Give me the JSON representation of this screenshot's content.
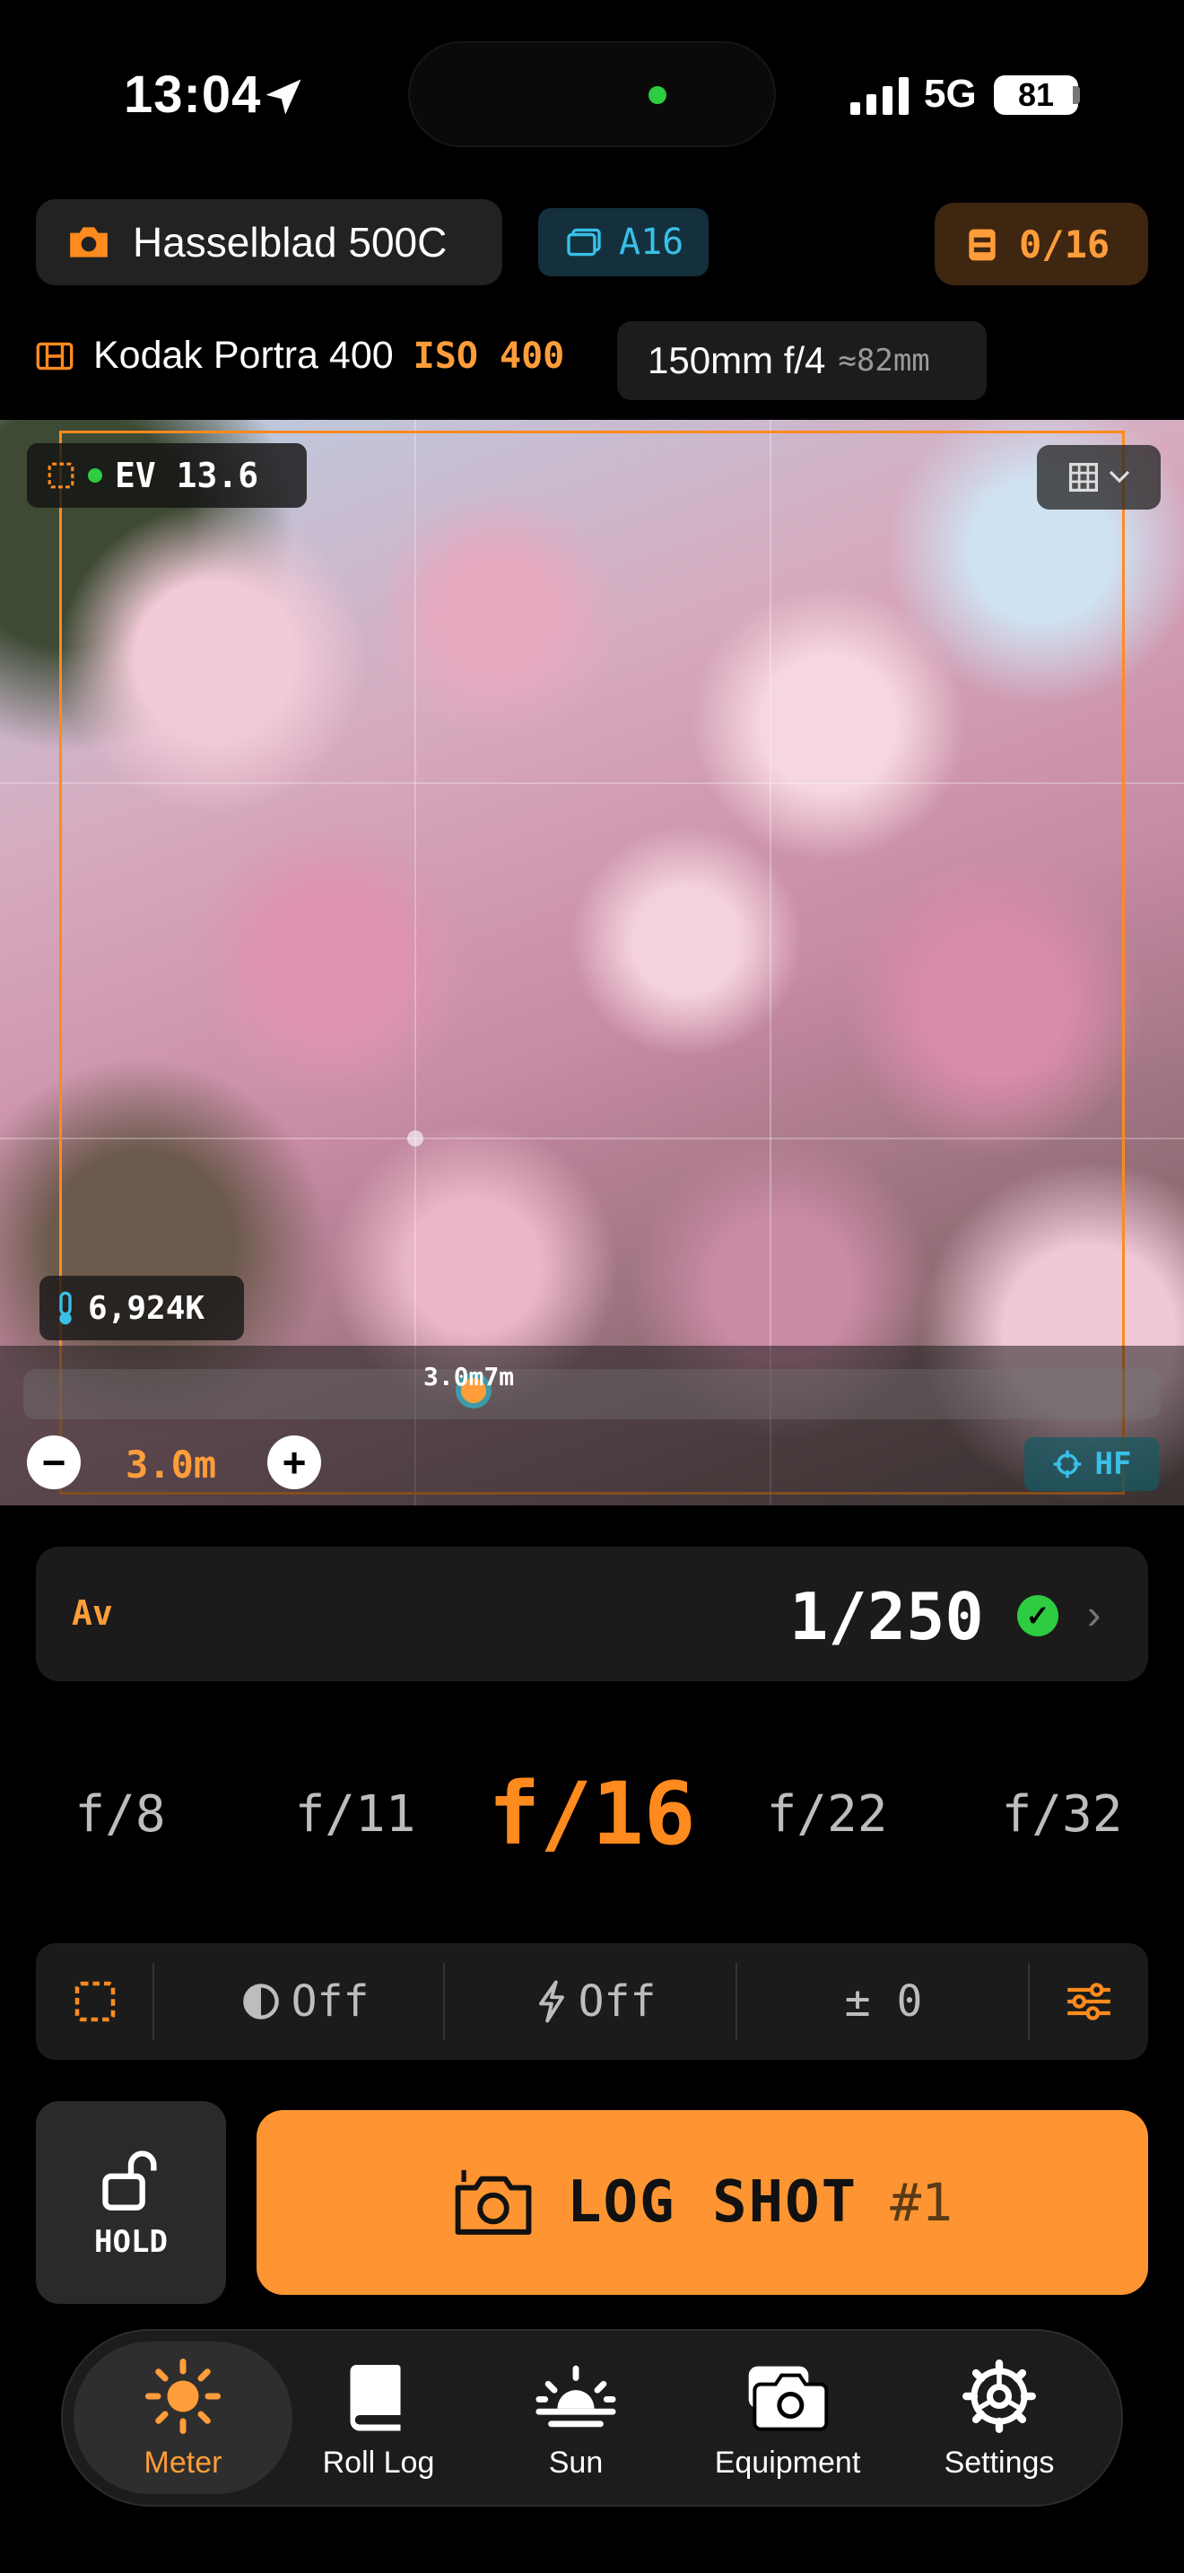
{
  "status_bar": {
    "time": "13:04",
    "network": "5G",
    "battery": "81"
  },
  "header": {
    "camera_name": "Hasselblad 500C",
    "back_label": "A16",
    "frame_count": "0/16",
    "film_name": "Kodak Portra 400",
    "iso_label": "ISO 400",
    "lens_label": "150mm f/4",
    "lens_equiv": "≈82mm"
  },
  "viewfinder": {
    "ev_label": "EV 13.6",
    "kelvin_label": "6,924K",
    "focus_marker_label": "3.0m7m",
    "focus_distance": "3.0m",
    "hf_label": "HF"
  },
  "exposure": {
    "mode": "Av",
    "shutter": "1/250",
    "apertures": [
      "f/8",
      "f/11",
      "f/16",
      "f/22",
      "f/32"
    ],
    "selected_aperture": "f/16"
  },
  "settings_bar": {
    "filter_label": "Off",
    "flash_label": "Off",
    "compensation_label": "± 0"
  },
  "actions": {
    "hold_label": "HOLD",
    "log_label": "LOG SHOT",
    "log_count": "#1"
  },
  "tabs": [
    {
      "label": "Meter",
      "icon": "sun-icon",
      "active": true
    },
    {
      "label": "Roll Log",
      "icon": "book-icon",
      "active": false
    },
    {
      "label": "Sun",
      "icon": "sunset-icon",
      "active": false
    },
    {
      "label": "Equipment",
      "icon": "cameras-icon",
      "active": false
    },
    {
      "label": "Settings",
      "icon": "gear-icon",
      "active": false
    }
  ],
  "colors": {
    "accent": "#ff9532",
    "info": "#39c0e8",
    "ok": "#2ecc40",
    "background": "#000000"
  }
}
